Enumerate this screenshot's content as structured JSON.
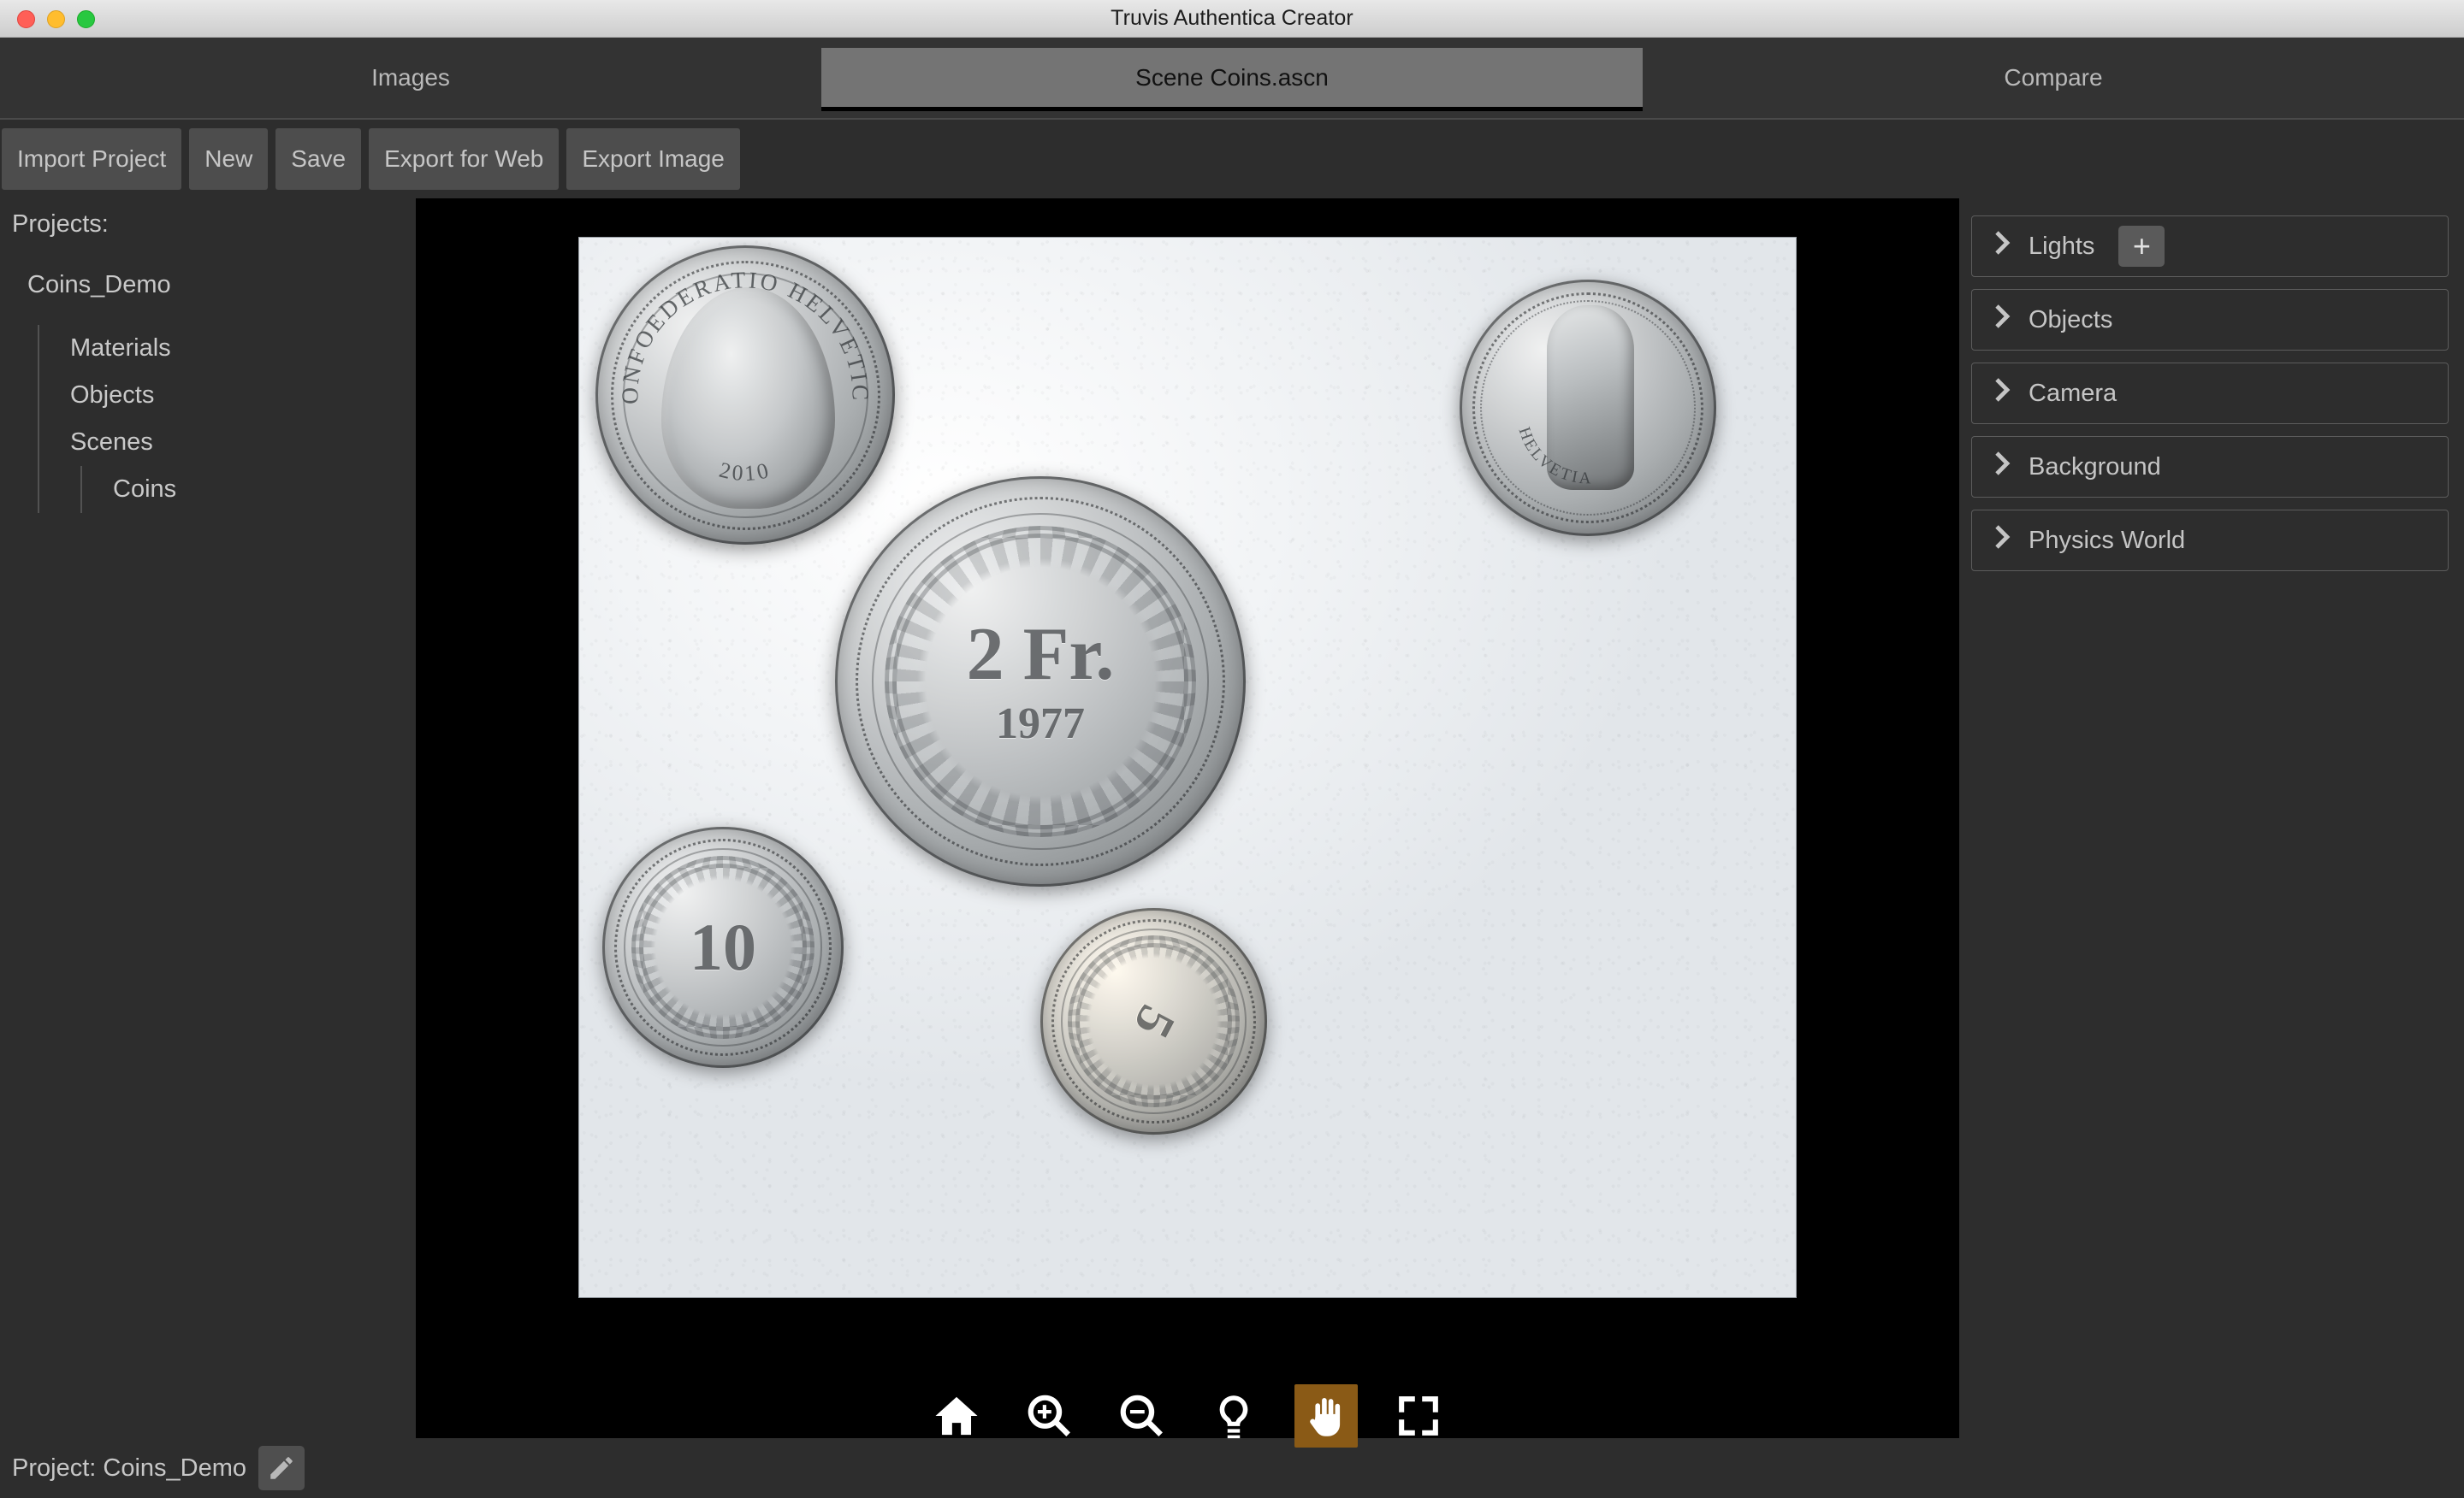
{
  "window": {
    "title": "Truvis Authentica Creator",
    "traffic_lights": [
      "close-button",
      "minimize-button",
      "maximize-button"
    ]
  },
  "tabs": [
    {
      "label": "Images",
      "active": false
    },
    {
      "label": "Scene Coins.ascn",
      "active": true
    },
    {
      "label": "Compare",
      "active": false
    }
  ],
  "toolbar": {
    "buttons": [
      {
        "label": "Import Project"
      },
      {
        "label": "New"
      },
      {
        "label": "Save"
      },
      {
        "label": "Export for Web"
      },
      {
        "label": "Export Image"
      }
    ]
  },
  "sidebar": {
    "header": "Projects:",
    "project": "Coins_Demo",
    "children": [
      {
        "label": "Materials"
      },
      {
        "label": "Objects"
      },
      {
        "label": "Scenes"
      }
    ],
    "scenes": [
      {
        "label": "Coins"
      }
    ]
  },
  "viewport": {
    "background_color": "#000000",
    "photo_alt": "Photograph of five Swiss coins on white paper",
    "coins": [
      {
        "id": "coin-2fr",
        "denomination": "2 Fr.",
        "year": "1977"
      },
      {
        "id": "coin-10rp",
        "denomination": "10",
        "year": ""
      },
      {
        "id": "coin-5rp",
        "denomination": "5",
        "year": ""
      },
      {
        "id": "coin-confoederatio",
        "legend_outer": "CONFOEDERATIO HELVETICA",
        "year": "2010"
      },
      {
        "id": "coin-helvetia",
        "legend_outer": "HELVETIA",
        "year": ""
      }
    ],
    "tools": [
      {
        "name": "home-icon",
        "label": "Home",
        "active": false
      },
      {
        "name": "zoom-in-icon",
        "label": "Zoom In",
        "active": false
      },
      {
        "name": "zoom-out-icon",
        "label": "Zoom Out",
        "active": false
      },
      {
        "name": "lightbulb-icon",
        "label": "Light",
        "active": false
      },
      {
        "name": "hand-icon",
        "label": "Pan",
        "active": true
      },
      {
        "name": "fullscreen-icon",
        "label": "Fit to View",
        "active": false
      }
    ],
    "active_tool_color": "#8a5a16"
  },
  "right_panel": {
    "sections": [
      {
        "label": "Lights",
        "has_add_button": true,
        "add_label": "+"
      },
      {
        "label": "Objects",
        "has_add_button": false
      },
      {
        "label": "Camera",
        "has_add_button": false
      },
      {
        "label": "Background",
        "has_add_button": false
      },
      {
        "label": "Physics World",
        "has_add_button": false
      }
    ]
  },
  "statusbar": {
    "project_label": "Project: Coins_Demo",
    "edit_icon": "pencil-icon"
  }
}
